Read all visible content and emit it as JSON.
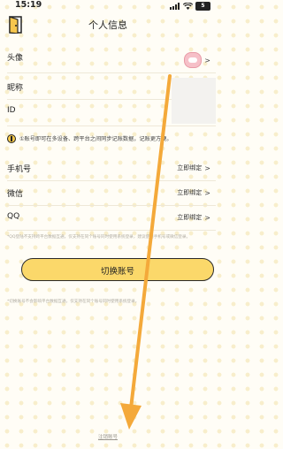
{
  "status_bar": {
    "time": "15:19",
    "battery": "5"
  },
  "nav": {
    "title": "个人信息"
  },
  "profile": {
    "avatar_label": "头像",
    "nickname_label": "昵称",
    "id_label": "ID"
  },
  "tip": {
    "text": "①账号即可在多设备、跨平台之间同步记账数据，记账更方便。"
  },
  "bindings": [
    {
      "label": "手机号",
      "action": "立即绑定"
    },
    {
      "label": "微信",
      "action": "立即绑定"
    },
    {
      "label": "QQ",
      "action": "立即绑定"
    }
  ],
  "note": "*QQ登陆不支持跨平台数据互通，仅支持在同个账号同时使用系统登录，建议使用手机号或微信登录。",
  "switch_account": "切换账号",
  "bottom_note": "*切换账号不会影响平台数据互通，仅支持在同个账号同时使用系统登录。",
  "deregister": "注销账号",
  "colors": {
    "accent": "#fbd86a",
    "arrow": "#f4a93a",
    "background": "#fffdf6"
  }
}
